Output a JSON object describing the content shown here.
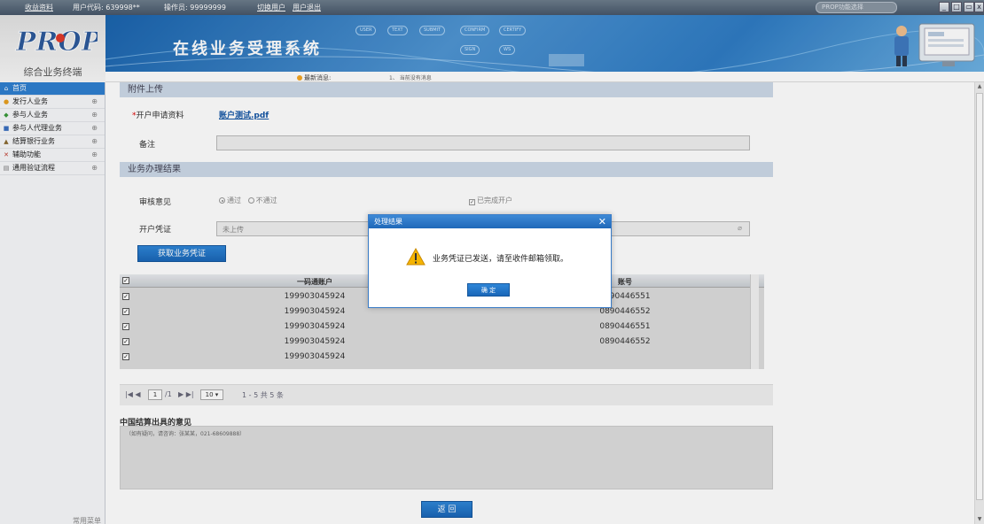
{
  "topbar": {
    "home": "收益资料",
    "user_code_label": "用户代码: 639998**",
    "operator_label": "操作员: 99999999",
    "switch_user": "切换用户",
    "logout": "用户退出",
    "select_value": "PROP功能选择",
    "win_min": "_",
    "win_restore": "□",
    "win_max": "▭",
    "win_close": "x"
  },
  "brand": {
    "logo_text": "PROP",
    "subtitle": "综合业务终端",
    "system_title": "在线业务受理系统",
    "flow_steps": [
      "USER",
      "TEXT",
      "SUBMIT",
      "CONFIRM",
      "CERTIFY",
      "SIGN",
      "WS"
    ]
  },
  "messages": {
    "label": "最新消息:",
    "text": "1、 当前没有消息"
  },
  "sidebar": {
    "items": [
      {
        "label": "首页",
        "icon": "home-icon",
        "glyph": "⌂",
        "expand": ""
      },
      {
        "label": "发行人业务",
        "icon": "person-icon",
        "glyph": "●",
        "expand": "⊕"
      },
      {
        "label": "参与人业务",
        "icon": "people-icon",
        "glyph": "◆",
        "expand": "⊕"
      },
      {
        "label": "参与人代理业务",
        "icon": "book-icon",
        "glyph": "■",
        "expand": "⊕"
      },
      {
        "label": "结算银行业务",
        "icon": "bank-icon",
        "glyph": "▲",
        "expand": "⊕"
      },
      {
        "label": "辅助功能",
        "icon": "tools-icon",
        "glyph": "✕",
        "expand": "⊕"
      },
      {
        "label": "通用验证流程",
        "icon": "flow-icon",
        "glyph": "▤",
        "expand": "⊕"
      }
    ],
    "footer": "常用菜单"
  },
  "attachment": {
    "section_title": "附件上传",
    "open_label": "开户申请资料",
    "required_mark": "*",
    "file_name": "账户测试.pdf",
    "remark_label": "备注"
  },
  "result": {
    "section_title": "业务办理结果",
    "review_label": "审核意见",
    "pass": "通过",
    "fail": "不通过",
    "done_open": "已完成开户",
    "voucher_label": "开户凭证",
    "voucher_value": "未上传",
    "get_voucher_btn": "获取业务凭证",
    "check_mark": "✓"
  },
  "grid": {
    "columns": [
      "一码通账户",
      "账号"
    ],
    "rows": [
      {
        "account": "199903045924",
        "number": "0890446551"
      },
      {
        "account": "199903045924",
        "number": "0890446552"
      },
      {
        "account": "199903045924",
        "number": "0890446551"
      },
      {
        "account": "199903045924",
        "number": "0890446552"
      },
      {
        "account": "199903045924",
        "number": ""
      }
    ],
    "pager": {
      "nav_first_prev": "|◀ ◀",
      "page": "1",
      "total_pages": "/1",
      "nav_next_last": "▶ ▶|",
      "page_size": "10 ▾",
      "summary": "1 - 5  共 5 条"
    }
  },
  "opinion": {
    "title": "中国结算出具的意见",
    "text": "（如有疑问，请咨询：张某某，021-68609888）"
  },
  "back_btn": "返 回",
  "dialog": {
    "title": "处理结果",
    "close": "✕",
    "message": "业务凭证已发送，请至收件邮箱领取。",
    "ok": "确 定"
  },
  "colors": {
    "accent": "#2e7fd0",
    "section_bg": "#ccd9e8",
    "warning": "#f5b400"
  }
}
